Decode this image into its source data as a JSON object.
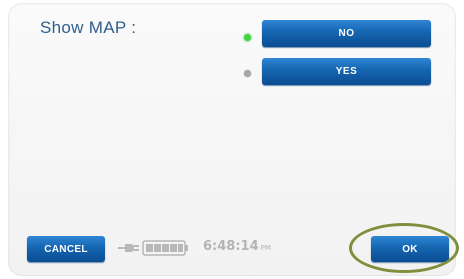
{
  "setting": {
    "label": "Show MAP :",
    "options": [
      {
        "label": "NO",
        "selected": true
      },
      {
        "label": "YES",
        "selected": false
      }
    ]
  },
  "footer": {
    "cancel_label": "CANCEL",
    "ok_label": "OK",
    "time": "6:48:14",
    "ampm": "PM",
    "battery_level": 1.0,
    "power_icon": "plug-icon",
    "battery_icon": "battery-icon"
  },
  "colors": {
    "button_blue": "#1565b0",
    "label_blue": "#2e5f8e",
    "selected_dot": "#3fd63f",
    "unselected_dot": "#a8a8a8",
    "highlight_ring": "#7f8f3e"
  }
}
